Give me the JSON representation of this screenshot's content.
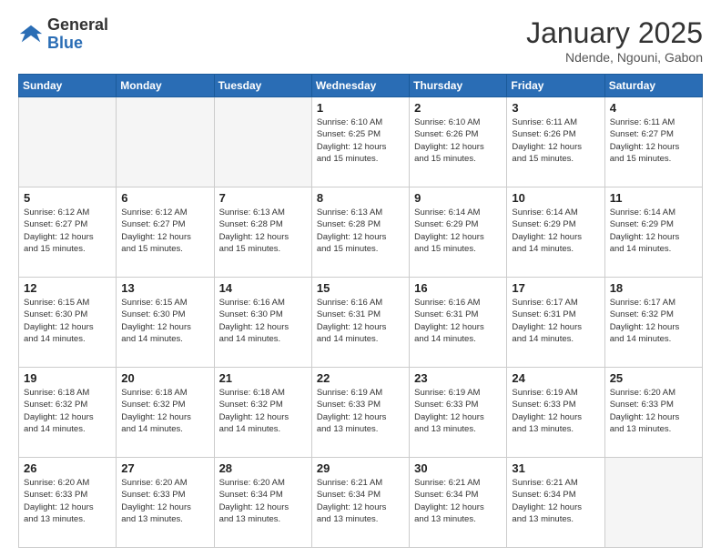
{
  "header": {
    "logo_general": "General",
    "logo_blue": "Blue",
    "title": "January 2025",
    "location": "Ndende, Ngouni, Gabon"
  },
  "days_of_week": [
    "Sunday",
    "Monday",
    "Tuesday",
    "Wednesday",
    "Thursday",
    "Friday",
    "Saturday"
  ],
  "weeks": [
    [
      {
        "day": "",
        "info": ""
      },
      {
        "day": "",
        "info": ""
      },
      {
        "day": "",
        "info": ""
      },
      {
        "day": "1",
        "info": "Sunrise: 6:10 AM\nSunset: 6:25 PM\nDaylight: 12 hours\nand 15 minutes."
      },
      {
        "day": "2",
        "info": "Sunrise: 6:10 AM\nSunset: 6:26 PM\nDaylight: 12 hours\nand 15 minutes."
      },
      {
        "day": "3",
        "info": "Sunrise: 6:11 AM\nSunset: 6:26 PM\nDaylight: 12 hours\nand 15 minutes."
      },
      {
        "day": "4",
        "info": "Sunrise: 6:11 AM\nSunset: 6:27 PM\nDaylight: 12 hours\nand 15 minutes."
      }
    ],
    [
      {
        "day": "5",
        "info": "Sunrise: 6:12 AM\nSunset: 6:27 PM\nDaylight: 12 hours\nand 15 minutes."
      },
      {
        "day": "6",
        "info": "Sunrise: 6:12 AM\nSunset: 6:27 PM\nDaylight: 12 hours\nand 15 minutes."
      },
      {
        "day": "7",
        "info": "Sunrise: 6:13 AM\nSunset: 6:28 PM\nDaylight: 12 hours\nand 15 minutes."
      },
      {
        "day": "8",
        "info": "Sunrise: 6:13 AM\nSunset: 6:28 PM\nDaylight: 12 hours\nand 15 minutes."
      },
      {
        "day": "9",
        "info": "Sunrise: 6:14 AM\nSunset: 6:29 PM\nDaylight: 12 hours\nand 15 minutes."
      },
      {
        "day": "10",
        "info": "Sunrise: 6:14 AM\nSunset: 6:29 PM\nDaylight: 12 hours\nand 14 minutes."
      },
      {
        "day": "11",
        "info": "Sunrise: 6:14 AM\nSunset: 6:29 PM\nDaylight: 12 hours\nand 14 minutes."
      }
    ],
    [
      {
        "day": "12",
        "info": "Sunrise: 6:15 AM\nSunset: 6:30 PM\nDaylight: 12 hours\nand 14 minutes."
      },
      {
        "day": "13",
        "info": "Sunrise: 6:15 AM\nSunset: 6:30 PM\nDaylight: 12 hours\nand 14 minutes."
      },
      {
        "day": "14",
        "info": "Sunrise: 6:16 AM\nSunset: 6:30 PM\nDaylight: 12 hours\nand 14 minutes."
      },
      {
        "day": "15",
        "info": "Sunrise: 6:16 AM\nSunset: 6:31 PM\nDaylight: 12 hours\nand 14 minutes."
      },
      {
        "day": "16",
        "info": "Sunrise: 6:16 AM\nSunset: 6:31 PM\nDaylight: 12 hours\nand 14 minutes."
      },
      {
        "day": "17",
        "info": "Sunrise: 6:17 AM\nSunset: 6:31 PM\nDaylight: 12 hours\nand 14 minutes."
      },
      {
        "day": "18",
        "info": "Sunrise: 6:17 AM\nSunset: 6:32 PM\nDaylight: 12 hours\nand 14 minutes."
      }
    ],
    [
      {
        "day": "19",
        "info": "Sunrise: 6:18 AM\nSunset: 6:32 PM\nDaylight: 12 hours\nand 14 minutes."
      },
      {
        "day": "20",
        "info": "Sunrise: 6:18 AM\nSunset: 6:32 PM\nDaylight: 12 hours\nand 14 minutes."
      },
      {
        "day": "21",
        "info": "Sunrise: 6:18 AM\nSunset: 6:32 PM\nDaylight: 12 hours\nand 14 minutes."
      },
      {
        "day": "22",
        "info": "Sunrise: 6:19 AM\nSunset: 6:33 PM\nDaylight: 12 hours\nand 13 minutes."
      },
      {
        "day": "23",
        "info": "Sunrise: 6:19 AM\nSunset: 6:33 PM\nDaylight: 12 hours\nand 13 minutes."
      },
      {
        "day": "24",
        "info": "Sunrise: 6:19 AM\nSunset: 6:33 PM\nDaylight: 12 hours\nand 13 minutes."
      },
      {
        "day": "25",
        "info": "Sunrise: 6:20 AM\nSunset: 6:33 PM\nDaylight: 12 hours\nand 13 minutes."
      }
    ],
    [
      {
        "day": "26",
        "info": "Sunrise: 6:20 AM\nSunset: 6:33 PM\nDaylight: 12 hours\nand 13 minutes."
      },
      {
        "day": "27",
        "info": "Sunrise: 6:20 AM\nSunset: 6:33 PM\nDaylight: 12 hours\nand 13 minutes."
      },
      {
        "day": "28",
        "info": "Sunrise: 6:20 AM\nSunset: 6:34 PM\nDaylight: 12 hours\nand 13 minutes."
      },
      {
        "day": "29",
        "info": "Sunrise: 6:21 AM\nSunset: 6:34 PM\nDaylight: 12 hours\nand 13 minutes."
      },
      {
        "day": "30",
        "info": "Sunrise: 6:21 AM\nSunset: 6:34 PM\nDaylight: 12 hours\nand 13 minutes."
      },
      {
        "day": "31",
        "info": "Sunrise: 6:21 AM\nSunset: 6:34 PM\nDaylight: 12 hours\nand 13 minutes."
      },
      {
        "day": "",
        "info": ""
      }
    ]
  ]
}
